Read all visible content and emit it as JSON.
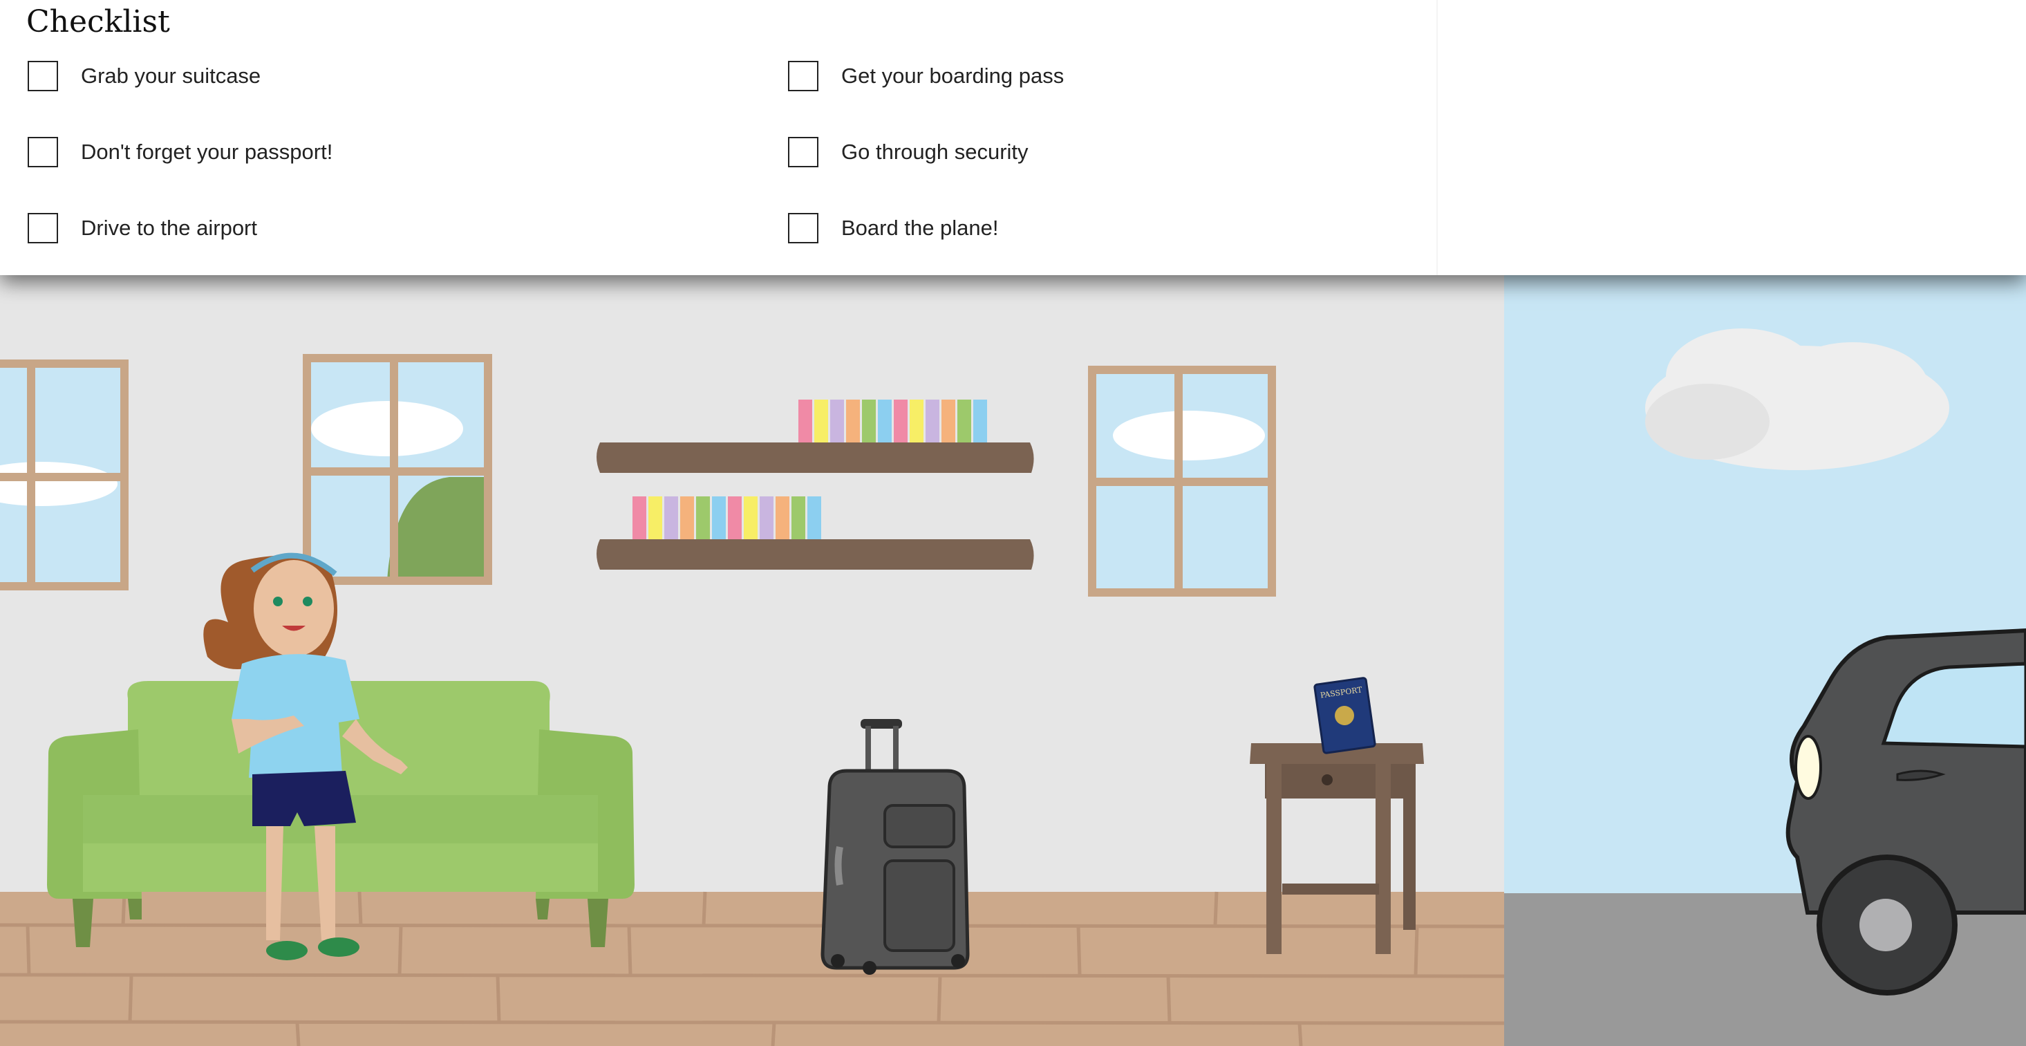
{
  "checklist": {
    "title": "Checklist",
    "items": [
      {
        "label": "Grab your suitcase",
        "checked": false
      },
      {
        "label": "Don't forget your passport!",
        "checked": false
      },
      {
        "label": "Drive to the airport",
        "checked": false
      },
      {
        "label": "Get your boarding pass",
        "checked": false
      },
      {
        "label": "Go through security",
        "checked": false
      },
      {
        "label": "Board the plane!",
        "checked": false
      }
    ]
  },
  "scene": {
    "passport_text": "PASSPORT",
    "colors": {
      "wall": "#e6e6e6",
      "floor": "#cca98b",
      "sky": "#c8e6f5",
      "sofa": "#9dc96b",
      "shelf": "#7b6352",
      "window_frame": "#c8a687",
      "suitcase": "#555555",
      "car": "#505152",
      "road": "#999999",
      "passport": "#203a7a"
    },
    "icons": [
      "girl-character",
      "sofa",
      "suitcase",
      "passport",
      "side-table",
      "car",
      "cloud",
      "bookshelf"
    ]
  }
}
